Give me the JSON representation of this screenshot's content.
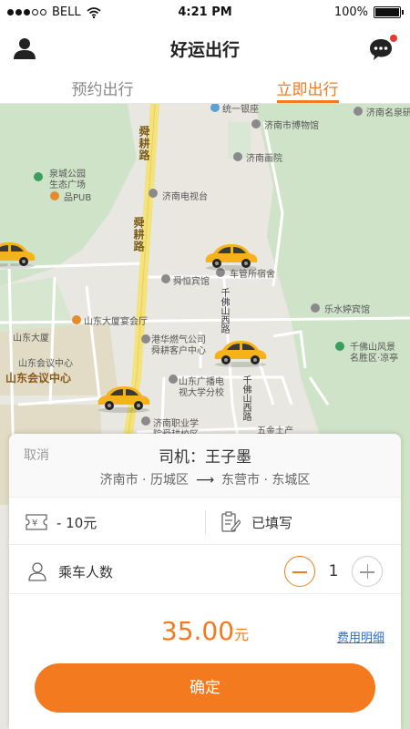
{
  "status_bar": {
    "carrier": "BELL",
    "time": "4:21 PM",
    "battery": "100%",
    "battery_level": 1.0
  },
  "header": {
    "title": "好运出行",
    "icons": [
      "user-icon",
      "chat-icon"
    ],
    "has_notification": true
  },
  "tabs": [
    {
      "label": "预约出行",
      "active": false
    },
    {
      "label": "立即出行",
      "active": true
    }
  ],
  "map": {
    "labels": {
      "l1": "统一银座",
      "l2": "济南市博物馆",
      "l3": "济南名泉研究会",
      "l4": "济南画院",
      "l5": "泉城公园",
      "l6": "生态广场",
      "l7": "品PUB",
      "l8": "济南电视台",
      "l9": "舜恒宾馆",
      "l10": "车管所宿舍",
      "l11": "乐水婷宾馆",
      "l12": "山东大厦宴会厅",
      "l13": "山东大厦",
      "l14": "港华燃气公司",
      "l15": "舜耕客户中心",
      "l16": "山东会议中心",
      "l17": "山东会议中心",
      "l18": "千佛山风景",
      "l19": "名胜区·凉亭",
      "l20": "山东广播电",
      "l21": "视大学分校",
      "l22": "济南职业学",
      "l23": "院舜耕校区",
      "l24": "五金土产",
      "r1": "舜耕路",
      "r2": "舜耕路",
      "r3": "千佛山西路",
      "r4": "千佛山西路"
    }
  },
  "order_card": {
    "cancel_label": "取消",
    "driver_label": "司机：王子墨",
    "from": "济南市 · 历城区",
    "arrow": "⟶",
    "to": "东营市 · 东城区",
    "coupon_text": "- 10元",
    "note_text": "已填写",
    "passengers_label": "乘车人数",
    "passenger_count": "1",
    "price_amount": "35.00",
    "price_unit": "元",
    "fee_detail_link": "费用明细",
    "confirm_label": "确定"
  },
  "colors": {
    "accent": "#f47a20",
    "link": "#2a6fd1",
    "taxi": "#f5b21a"
  }
}
